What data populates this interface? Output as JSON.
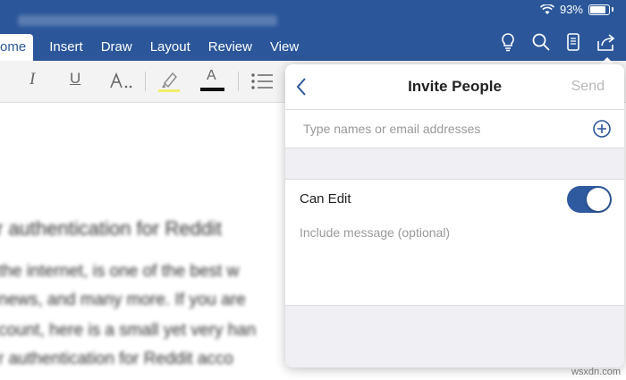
{
  "status": {
    "battery": "93%"
  },
  "ribbon": {
    "tabs": [
      "ome",
      "Insert",
      "Draw",
      "Layout",
      "Review",
      "View"
    ],
    "active_tab": "ome"
  },
  "toolbar": {
    "italic": "I",
    "underline": "U",
    "font_color_glyph": "A"
  },
  "document": {
    "lines": [
      "r authentication for Reddit",
      "the internet, is one of the best w",
      "news, and many more. If you are",
      "count, here is a small yet very han",
      "r authentication for Reddit acco"
    ]
  },
  "invite": {
    "title": "Invite People",
    "send": "Send",
    "names_placeholder": "Type names or email addresses",
    "can_edit": "Can Edit",
    "can_edit_on": true,
    "message_placeholder": "Include message (optional)"
  },
  "watermark": "wsxdn.com",
  "colors": {
    "ribbon": "#2b579a",
    "toggle": "#2f5aa0"
  }
}
